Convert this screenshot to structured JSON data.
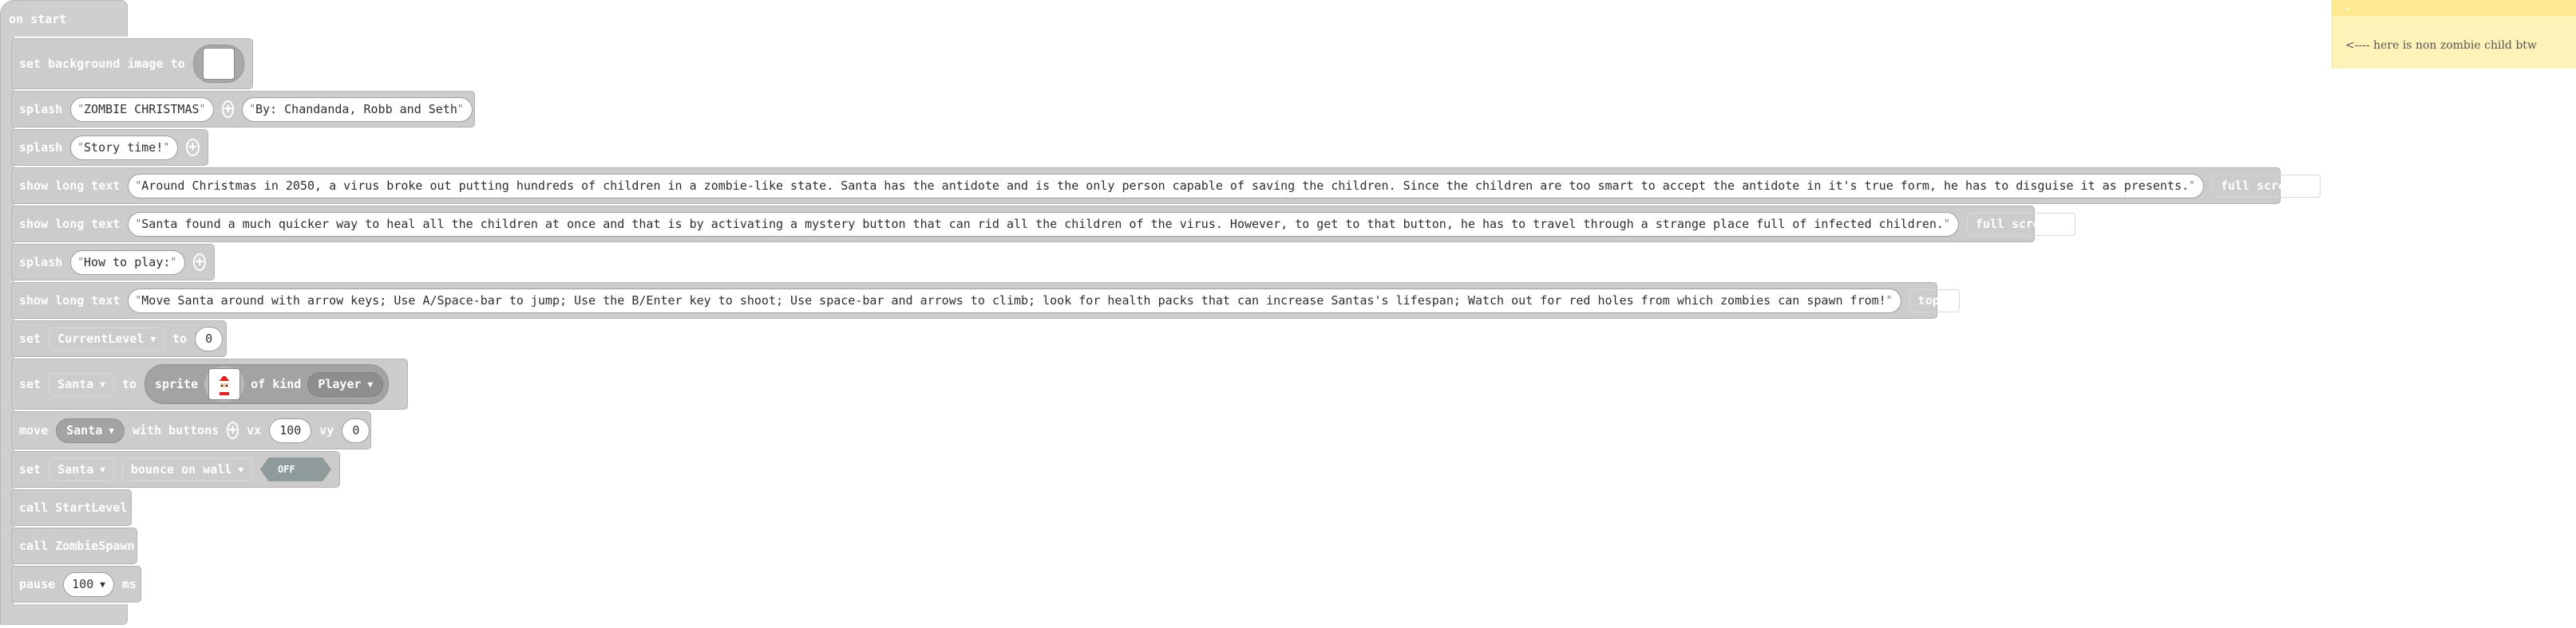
{
  "event": {
    "label": "on start"
  },
  "blocks": {
    "set_bg": {
      "label": "set background image to"
    },
    "splash1": {
      "label": "splash",
      "title": "ZOMBIE CHRISTMAS",
      "subtitle": "By: Chandanda, Robb and Seth"
    },
    "splash2": {
      "label": "splash",
      "title": "Story time!"
    },
    "longtext1": {
      "label": "show long text",
      "text": "Around Christmas in 2050, a virus broke out putting hundreds of children in a zombie-like state. Santa has the antidote and is the only person capable of saving the children. Since the children are too smart to accept the antidote in it's true form, he has to disguise it as presents.",
      "placement": "full screen"
    },
    "longtext2": {
      "label": "show long text",
      "text": "Santa found a much quicker way to heal all the children at once and that is by activating a mystery button that can rid all the children of the virus. However, to get to that button, he has to travel through a strange place full of infected children.",
      "placement": "full screen"
    },
    "splash3": {
      "label": "splash",
      "title": "How to play:"
    },
    "longtext3": {
      "label": "show long text",
      "text": "Move Santa around with arrow keys; Use A/Space-bar to jump; Use the B/Enter key to shoot; Use space-bar and arrows to climb; look for health packs that can increase Santas's lifespan;  Watch out for red holes from which zombies can spawn from!",
      "placement": "top"
    },
    "set_level": {
      "set": "set",
      "variable": "CurrentLevel",
      "to": "to",
      "value": "0"
    },
    "set_santa": {
      "set": "set",
      "variable": "Santa",
      "to": "to",
      "sprite": "sprite",
      "of_kind": "of kind",
      "kind": "Player"
    },
    "move": {
      "label": "move",
      "sprite": "Santa",
      "with_buttons": "with buttons",
      "vx_label": "vx",
      "vx": "100",
      "vy_label": "vy",
      "vy": "0"
    },
    "set_bounce": {
      "set": "set",
      "sprite": "Santa",
      "flag": "bounce on wall",
      "toggle": "OFF"
    },
    "call1": {
      "label": "call StartLevel"
    },
    "call2": {
      "label": "call ZombieSpawn"
    },
    "pause": {
      "label": "pause",
      "value": "100",
      "unit": "ms"
    }
  },
  "comment": {
    "text": "<---- here is non zombie child btw"
  },
  "colors": {
    "block": "#cccccc",
    "hat": "#cfcfcf",
    "toggle": "#8f9a9a",
    "note": "#fff2b8",
    "note_bar": "#fde98f"
  },
  "icons": {
    "add": "plus-circle-icon",
    "dropdown": "caret-down-icon",
    "santa": "santa-sprite-icon"
  }
}
